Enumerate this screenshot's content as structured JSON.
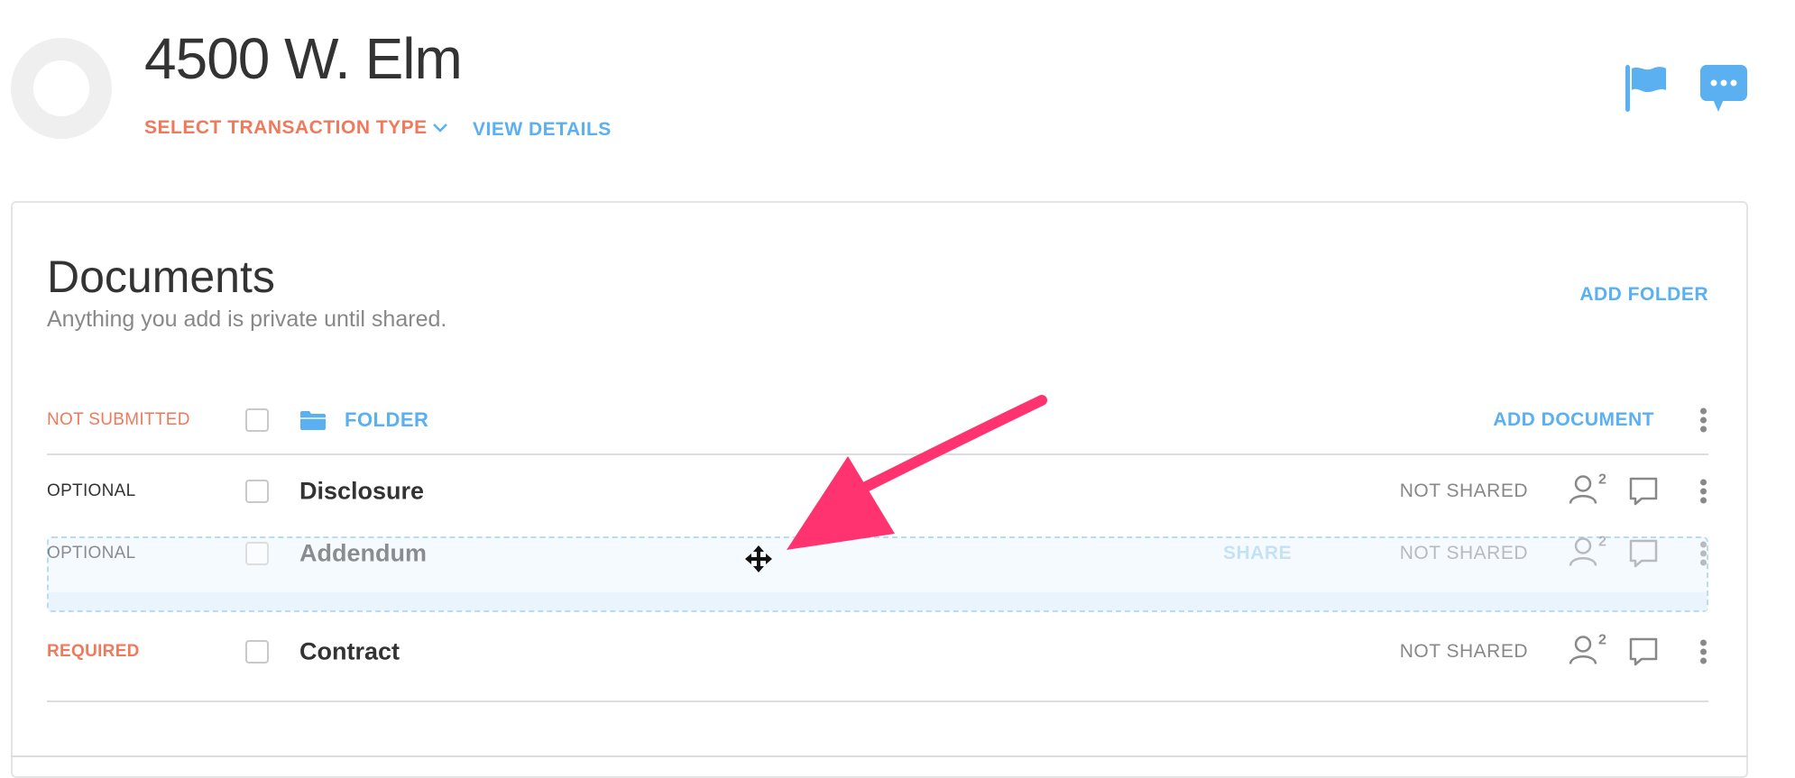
{
  "header": {
    "title": "4500 W. Elm",
    "transaction_type_label": "SELECT TRANSACTION TYPE",
    "view_details_label": "VIEW DETAILS"
  },
  "documents": {
    "heading": "Documents",
    "subheading": "Anything you add is private until shared.",
    "add_folder_label": "ADD FOLDER",
    "folder_row": {
      "status": "NOT SUBMITTED",
      "folder_label": "FOLDER",
      "add_document_label": "ADD DOCUMENT"
    },
    "rows": [
      {
        "status": "OPTIONAL",
        "name": "Disclosure",
        "shared": "NOT SHARED",
        "people_count": "2"
      },
      {
        "status": "OPTIONAL",
        "name": "Addendum",
        "share_label": "SHARE",
        "shared": "NOT SHARED",
        "people_count": "2"
      },
      {
        "status": "REQUIRED",
        "name": "Contract",
        "shared": "NOT SHARED",
        "people_count": "2"
      }
    ]
  },
  "colors": {
    "accent_blue": "#5ab0f0",
    "accent_orange": "#f0795c",
    "arrow_pink": "#ff3370"
  }
}
